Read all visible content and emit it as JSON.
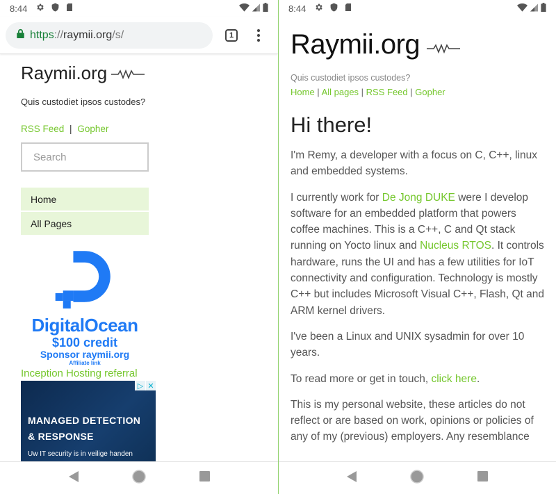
{
  "status_bar": {
    "time": "8:44",
    "icons": [
      "gear-icon",
      "shield-icon",
      "sd-card-icon"
    ],
    "right_icons": [
      "wifi-icon",
      "signal-icon",
      "battery-icon"
    ]
  },
  "browser": {
    "url_scheme": "https",
    "url_sep": "://",
    "url_host": "raymii.org",
    "url_path": "/s/",
    "tab_count": "1"
  },
  "left_page": {
    "site_title": "Raymii.org",
    "tagline": "Quis custodiet ipsos custodes?",
    "links": [
      {
        "label": "RSS Feed"
      },
      {
        "label": "Gopher"
      }
    ],
    "link_separator": "|",
    "search_placeholder": "Search",
    "nav": [
      {
        "label": "Home"
      },
      {
        "label": "All Pages"
      }
    ],
    "do_ad": {
      "brand": "DigitalOcean",
      "credit": "$100 credit",
      "sponsor": "Sponsor raymii.org",
      "affiliate": "Affiliate link"
    },
    "inception_link": "Inception Hosting referral",
    "ad_banner": {
      "headline_1": "MANAGED DETECTION",
      "headline_2": "& RESPONSE",
      "subtext": "Uw IT security is in veilige handen",
      "adchoices": "▷",
      "close": "✕"
    }
  },
  "right_page": {
    "site_title": "Raymii.org",
    "tagline": "Quis custodiet ipsos custodes?",
    "nav_links": [
      {
        "label": "Home"
      },
      {
        "label": "All pages"
      },
      {
        "label": "RSS Feed"
      },
      {
        "label": "Gopher"
      }
    ],
    "separator": " | ",
    "heading": "Hi there!",
    "p1": "I'm Remy, a developer with a focus on C, C++, linux and embedded systems.",
    "p2_a": "I currently work for ",
    "p2_link1": "De Jong DUKE",
    "p2_b": " were I develop software for an embedded platform that powers coffee machines. This is a C++, C and Qt stack running on Yocto linux and ",
    "p2_link2": "Nucleus RTOS",
    "p2_c": ". It controls hardware, runs the UI and has a few utilities for IoT connectivity and configuration. Technology is mostly C++ but includes Microsoft Visual C++, Flash, Qt and ARM kernel drivers.",
    "p3": "I've been a Linux and UNIX sysadmin for over 10 years.",
    "p4_a": "To read more or get in touch, ",
    "p4_link": "click here",
    "p4_b": ".",
    "p5": "This is my personal website, these articles do not reflect or are based on work, opinions or policies of any of my (previous) employers. Any resemblance"
  },
  "colors": {
    "link_green": "#75c72d",
    "nav_bg": "#e8f6d9",
    "do_blue": "#1f7af5",
    "secure_green": "#188038",
    "divider_green": "#8fd16b"
  }
}
